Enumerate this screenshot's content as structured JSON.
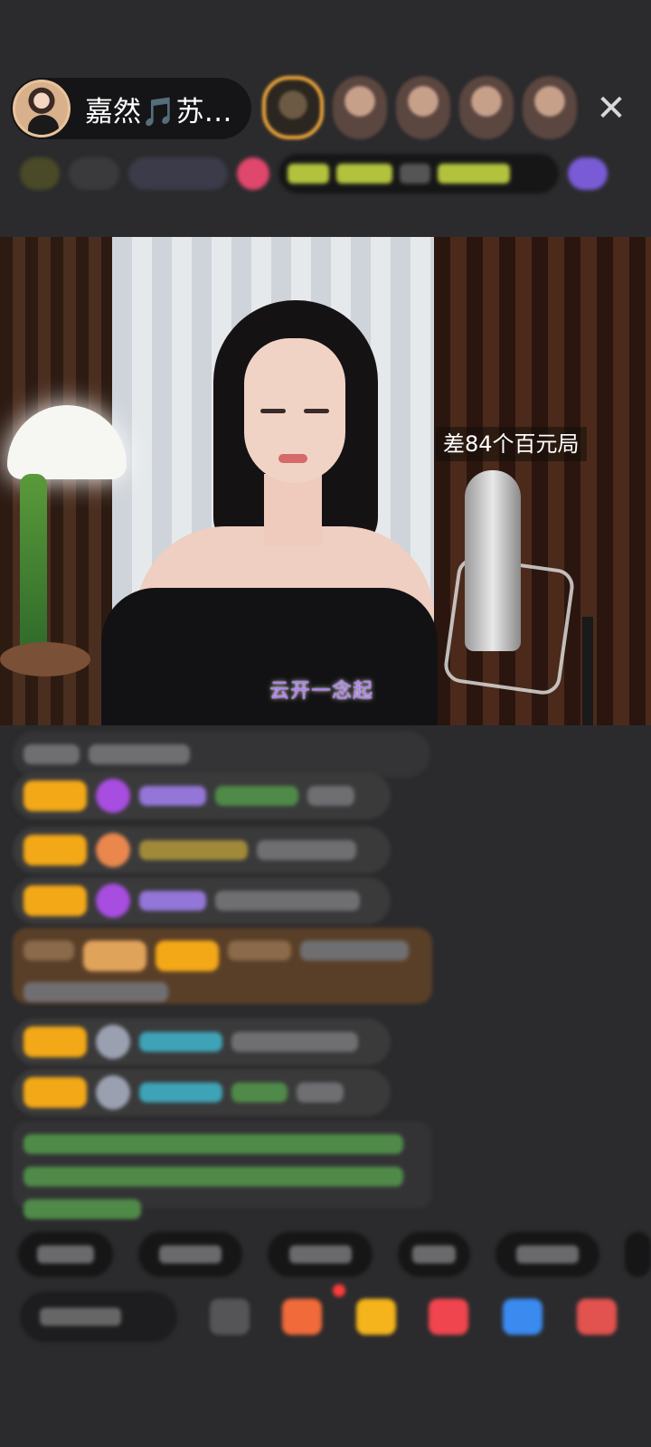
{
  "header": {
    "host_name": "嘉然🎵苏…",
    "close_icon": "close-icon"
  },
  "video": {
    "badge_text": "差84个百元局",
    "lyric_text": "云开一念起"
  },
  "colors": {
    "background": "#2b2b2d",
    "pill": "#151517",
    "badge_gold": "#f3a817",
    "lyric_purple": "#b57dff"
  }
}
